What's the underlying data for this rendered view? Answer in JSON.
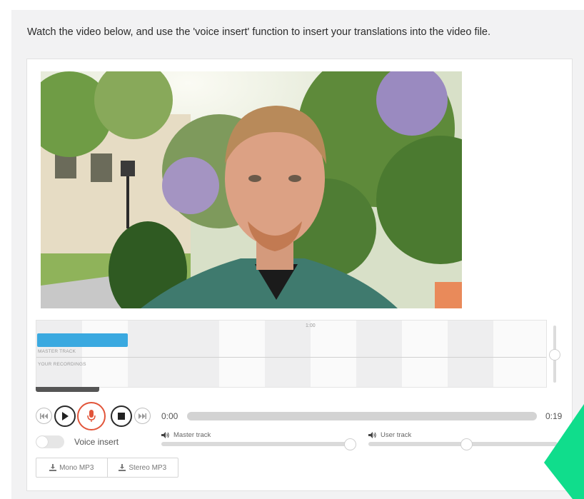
{
  "instruction": "Watch the video below, and use the 'voice insert' function to insert your translations into the video file.",
  "timeline": {
    "tick_label": "1:00",
    "master_label": "MASTER TRACK",
    "recordings_label": "YOUR RECORDINGS"
  },
  "player": {
    "current_time": "0:00",
    "duration": "0:19",
    "progress": 0
  },
  "voice_insert": {
    "label": "Voice insert",
    "enabled": false
  },
  "volumes": {
    "master": {
      "label": "Master track",
      "level": 0.91
    },
    "user": {
      "label": "User track",
      "level": 0.5
    }
  },
  "downloads": {
    "mono": "Mono MP3",
    "stereo": "Stereo MP3"
  },
  "colors": {
    "master_track_bar": "#3aa9e0",
    "record_accent": "#e2553a",
    "corner_accent": "#10dd8c"
  },
  "icons": {
    "rewind": "skip-back-icon",
    "play": "play-icon",
    "record": "microphone-icon",
    "stop": "stop-icon",
    "forward": "skip-forward-icon",
    "volume": "speaker-icon",
    "download": "download-icon"
  }
}
